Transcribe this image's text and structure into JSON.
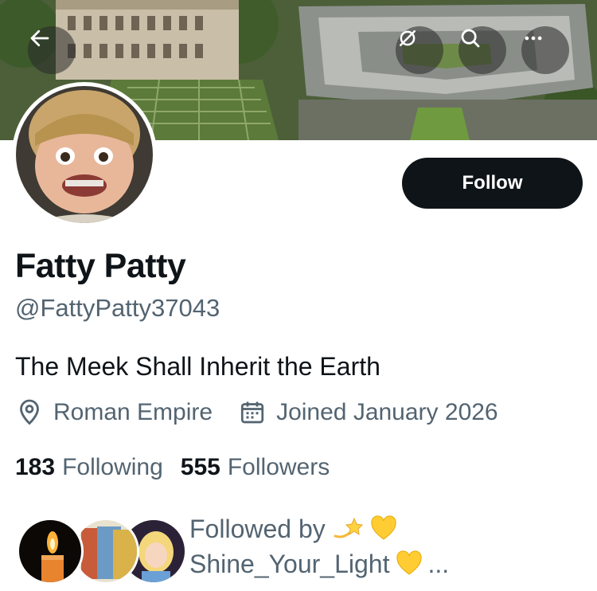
{
  "header": {
    "back_icon": "arrow-left-icon",
    "translate_icon": "translate-off-icon",
    "search_icon": "search-icon",
    "more_icon": "more-horizontal-icon"
  },
  "profile": {
    "display_name": "Fatty Patty",
    "handle": "@FattyPatty37043",
    "bio": "The Meek Shall Inherit the Earth",
    "location": "Roman Empire",
    "joined": "Joined January 2026",
    "follow_label": "Follow"
  },
  "stats": {
    "following_count": "183",
    "following_label": "Following",
    "followers_count": "555",
    "followers_label": "Followers"
  },
  "followed_by": {
    "prefix": "Followed by",
    "name": "Shine_Your_Light",
    "suffix": "..."
  },
  "colors": {
    "text_primary": "#0f1419",
    "text_secondary": "#536471",
    "follow_bg": "#0f1419"
  }
}
